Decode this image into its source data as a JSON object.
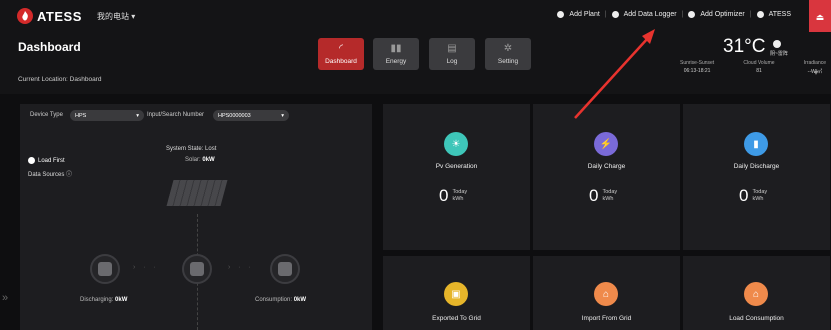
{
  "brand": {
    "name": "ATESS"
  },
  "topbar": {
    "plant_selector": "我的电站 ▾",
    "actions": [
      {
        "label": "Add Plant"
      },
      {
        "label": "Add Data Logger"
      },
      {
        "label": "Add Optimizer"
      },
      {
        "label": "ATESS"
      }
    ],
    "logout_icon": "logout-icon"
  },
  "header": {
    "title": "Dashboard",
    "location": "Current Location: Dashboard"
  },
  "nav": [
    {
      "label": "Dashboard",
      "glyph": "◜",
      "active": true
    },
    {
      "label": "Energy",
      "glyph": "▮▮",
      "active": false
    },
    {
      "label": "Log",
      "glyph": "▤",
      "active": false
    },
    {
      "label": "Setting",
      "glyph": "✲",
      "active": false
    }
  ],
  "weather": {
    "temp": "31°C",
    "condition": "阴~雷阵",
    "cols": [
      {
        "label": "Sunrise-Sunset",
        "value": "06:13-18:21"
      },
      {
        "label": "Cloud Volume",
        "value": "81"
      },
      {
        "label": "Irradiance",
        "value": "--W/㎡"
      }
    ]
  },
  "device": {
    "type_label": "Device Type",
    "type_value": "HPS",
    "search_label": "Input/Search Number",
    "search_value": "HPS0000003",
    "system_state": "System State:  Lost",
    "solar_label": "Solar:",
    "solar_value": "0kW",
    "load_first": "Load First",
    "data_sources": "Data Sources ⓘ",
    "discharging_label": "Discharging:",
    "discharging_value": "0kW",
    "consumption_label": "Consumption:",
    "consumption_value": "0kW"
  },
  "cards": [
    {
      "label": "Pv Generation",
      "value": "0",
      "sub": "Today",
      "unit": "kWh",
      "color": "#3ec6b9"
    },
    {
      "label": "Daily Charge",
      "value": "0",
      "sub": "Today",
      "unit": "kWh",
      "color": "#7a6ad8"
    },
    {
      "label": "Daily Discharge",
      "value": "0",
      "sub": "Today",
      "unit": "kWh",
      "color": "#3e9ae6"
    },
    {
      "label": "Exported To Grid",
      "color": "#e6b52a"
    },
    {
      "label": "Import From Grid",
      "color": "#ef8a4b"
    },
    {
      "label": "Load Consumption",
      "color": "#ef8a4b"
    }
  ]
}
